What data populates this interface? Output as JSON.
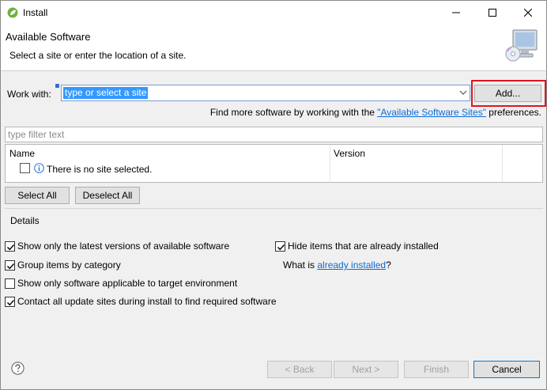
{
  "window": {
    "title": "Install",
    "icon": "spring-leaf-icon",
    "controls": [
      "minimize-icon",
      "maximize-icon",
      "close-icon"
    ]
  },
  "header": {
    "title": "Available Software",
    "description": "Select a site or enter the location of a site."
  },
  "work_with": {
    "label": "Work with:",
    "value": "type or select a site",
    "add_button": "Add...",
    "find_more_prefix": "Find more software by working with the ",
    "find_more_link": "\"Available Software Sites\"",
    "find_more_suffix": " preferences."
  },
  "filter": {
    "placeholder": "type filter text"
  },
  "table": {
    "columns": [
      "Name",
      "Version"
    ],
    "empty_row": "There is no site selected."
  },
  "selection": {
    "select_all": "Select All",
    "deselect_all": "Deselect All"
  },
  "details": {
    "label": "Details",
    "options": [
      {
        "label": "Show only the latest versions of available software",
        "checked": true
      },
      {
        "label": "Group items by category",
        "checked": true
      },
      {
        "label": "Show only software applicable to target environment",
        "checked": false
      },
      {
        "label": "Contact all update sites during install to find required software",
        "checked": true
      }
    ],
    "hide_installed": {
      "label": "Hide items that are already installed",
      "checked": true
    },
    "what_is_prefix": "What is ",
    "what_is_link": "already installed",
    "what_is_suffix": "?"
  },
  "footer": {
    "back": "< Back",
    "next": "Next >",
    "finish": "Finish",
    "cancel": "Cancel"
  },
  "colors": {
    "accent": "#0078d7",
    "highlight": "#e0141e",
    "link": "#0a6bd6",
    "selection": "#3399ff"
  }
}
